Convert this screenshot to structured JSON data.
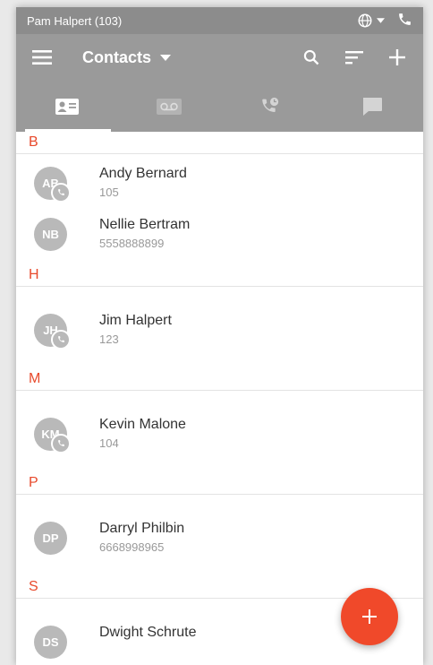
{
  "status": {
    "user": "Pam Halpert (103)"
  },
  "toolbar": {
    "title": "Contacts"
  },
  "colors": {
    "accent": "#f0492a",
    "header": "#9a9a9a"
  },
  "tabs": [
    {
      "icon": "contact-card-icon",
      "active": true
    },
    {
      "icon": "voicemail-icon",
      "active": false
    },
    {
      "icon": "call-history-icon",
      "active": false
    },
    {
      "icon": "chat-icon",
      "active": false
    }
  ],
  "sections": [
    {
      "letter": "B",
      "contacts": [
        {
          "initials": "AB",
          "name": "Andy Bernard",
          "number": "105",
          "callbadge": true
        },
        {
          "initials": "NB",
          "name": "Nellie Bertram",
          "number": "5558888899",
          "callbadge": false
        }
      ]
    },
    {
      "letter": "H",
      "contacts": [
        {
          "initials": "JH",
          "name": "Jim Halpert",
          "number": "123",
          "callbadge": true
        }
      ]
    },
    {
      "letter": "M",
      "contacts": [
        {
          "initials": "KM",
          "name": "Kevin Malone",
          "number": "104",
          "callbadge": true
        }
      ]
    },
    {
      "letter": "P",
      "contacts": [
        {
          "initials": "DP",
          "name": "Darryl Philbin",
          "number": "6668998965",
          "callbadge": false
        }
      ]
    },
    {
      "letter": "S",
      "contacts": [
        {
          "initials": "DS",
          "name": "Dwight Schrute",
          "number": "",
          "callbadge": false
        }
      ]
    }
  ]
}
